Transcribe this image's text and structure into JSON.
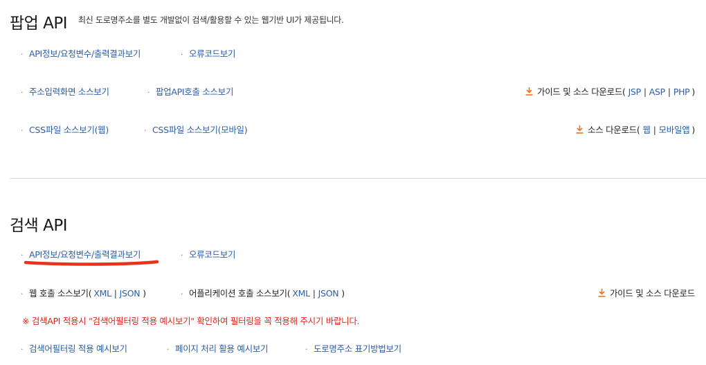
{
  "popup": {
    "title": "팝업 API",
    "description": "최신 도로명주소를 별도 개발없이 검색/활용할 수 있는 웹기반 UI가 제공됩니다.",
    "links": {
      "api_info": "API정보/요청변수/출력결과보기",
      "error_code": "오류코드보기",
      "addr_input_source": "주소입력화면 소스보기",
      "popup_call_source": "팝업API호출 소스보기",
      "css_web": "CSS파일 소스보기(웹)",
      "css_mobile": "CSS파일 소스보기(모바일)"
    },
    "guide_download": {
      "label": "가이드 및 소스 다운로드(",
      "jsp": "JSP",
      "asp": "ASP",
      "php": "PHP",
      "close": ")"
    },
    "source_download": {
      "label": "소스 다운로드(",
      "web": "웹",
      "mobile": "모바일앱",
      "close": ")"
    }
  },
  "search": {
    "title": "검색 API",
    "links": {
      "api_info": "API정보/요청변수/출력결과보기",
      "error_code": "오류코드보기",
      "filter_example": "검색어필터링 적용 예시보기",
      "paging_example": "페이지 처리 활용 예시보기",
      "road_addr_notation": "도로명주소 표기방법보기"
    },
    "web_call": {
      "label": "웹 호출 소스보기(",
      "xml": "XML",
      "json": "JSON",
      "close": ")"
    },
    "app_call": {
      "label": "어플리케이션 호출 소스보기(",
      "xml": "XML",
      "json": "JSON",
      "close": ")"
    },
    "guide_download": "가이드 및 소스 다운로드",
    "notice": "※ 검색API 적용시 \"검색어필터링 적용 예시보기\" 확인하여 필터링을 꼭 적용해 주시기 바랍니다."
  },
  "colors": {
    "link": "#2a5ea8",
    "notice": "#e2231a",
    "download_icon": "#e8731f",
    "highlight_stroke": "#e8331a"
  },
  "icons": {
    "bullet": "·",
    "download": "download-arrow-icon",
    "separator": "|"
  }
}
